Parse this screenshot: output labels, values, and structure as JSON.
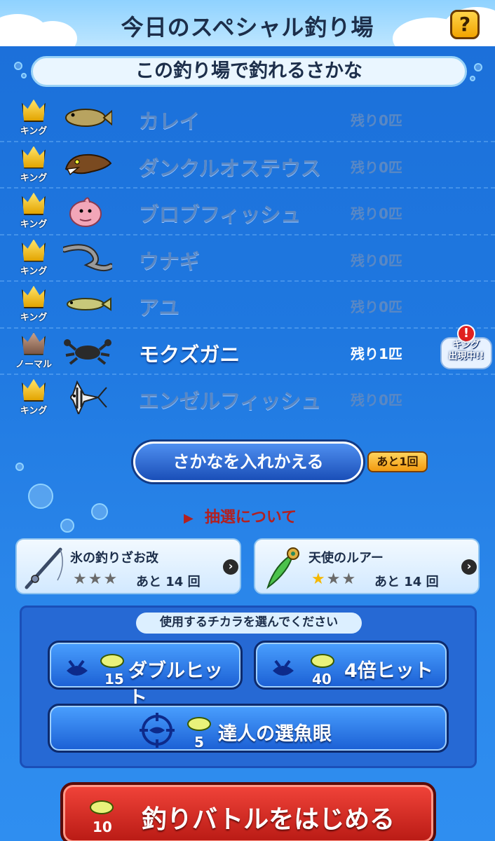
{
  "header": {
    "title": "今日のスペシャル釣り場",
    "help_label": "?"
  },
  "section_title": "この釣り場で釣れるさかな",
  "fish": [
    {
      "rank": "キング",
      "name": "カレイ",
      "remain": "残り0匹",
      "color": "#b8a360"
    },
    {
      "rank": "キング",
      "name": "ダンクルオステウス",
      "remain": "残り0匹",
      "color": "#7a4a20"
    },
    {
      "rank": "キング",
      "name": "ブロブフィッシュ",
      "remain": "残り0匹",
      "color": "#f2a6b8"
    },
    {
      "rank": "キング",
      "name": "ウナギ",
      "remain": "残り0匹",
      "color": "#4a4a4a"
    },
    {
      "rank": "キング",
      "name": "アユ",
      "remain": "残り0匹",
      "color": "#b8b860"
    },
    {
      "rank": "ノーマル",
      "name": "モクズガニ",
      "remain": "残り1匹",
      "color": "#2a2a2a",
      "badge": "キング\n出現中!!"
    },
    {
      "rank": "キング",
      "name": "エンゼルフィッシュ",
      "remain": "残り0匹",
      "color": "#e8e8e8"
    }
  ],
  "king_badge": {
    "line1": "キング",
    "line2": "出現中!!",
    "mark": "!"
  },
  "swap": {
    "label": "さかなを入れかえる",
    "count": "あと1回"
  },
  "lottery": {
    "marker": "▶",
    "label": "抽選について"
  },
  "equipment": [
    {
      "name": "氷の釣りざお改",
      "stars": [
        "off",
        "off",
        "off"
      ],
      "remain": "あと 14 回",
      "arrow": "›"
    },
    {
      "name": "天使のルアー",
      "stars": [
        "on",
        "off",
        "off"
      ],
      "remain": "あと 14 回",
      "arrow": "›"
    }
  ],
  "skill": {
    "heading": "使用するチカラを選んでください",
    "buttons": [
      {
        "label": "ダブルヒット",
        "cost": "15"
      },
      {
        "label": "4倍ヒット",
        "cost": "40"
      },
      {
        "label": "達人の選魚眼",
        "cost": "5"
      }
    ]
  },
  "start": {
    "label": "釣りバトルをはじめる",
    "cost": "10"
  }
}
